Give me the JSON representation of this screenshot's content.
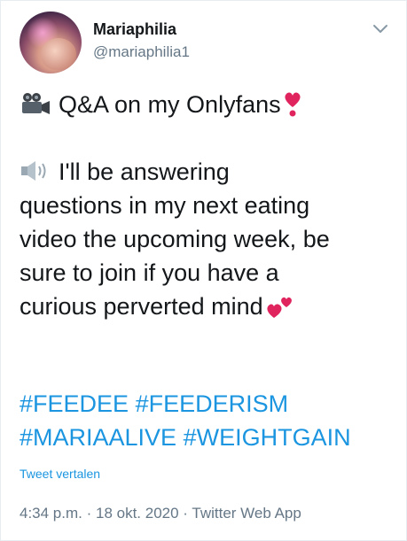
{
  "user": {
    "display_name": "Mariaphilia",
    "handle": "@mariaphilia1"
  },
  "icons": {
    "menu": "chevron-down-icon",
    "camera": "movie-camera-icon",
    "heart": "red-heart-icon",
    "speaker": "speaker-icon",
    "two_hearts": "two-hearts-icon"
  },
  "tweet": {
    "line1": "Q&A on my Onlyfans",
    "line3": "I'll be answering",
    "line4": "questions in my next eating",
    "line5": "video the upcoming week, be",
    "line6": "sure to join if you have a",
    "line7": "curious perverted mind",
    "hashtags": [
      "#FEEDEE",
      "#FEEDERISM",
      "#MARIAALIVE",
      "#WEIGHTGAIN"
    ]
  },
  "translate_label": "Tweet vertalen",
  "meta": {
    "time": "4:34 p.m.",
    "separator1": " · ",
    "date": "18 okt. 2020",
    "separator2": " · ",
    "source": "Twitter Web App"
  },
  "colors": {
    "link": "#1b95e0",
    "secondary_text": "#657786",
    "heart": "#e0245e"
  }
}
